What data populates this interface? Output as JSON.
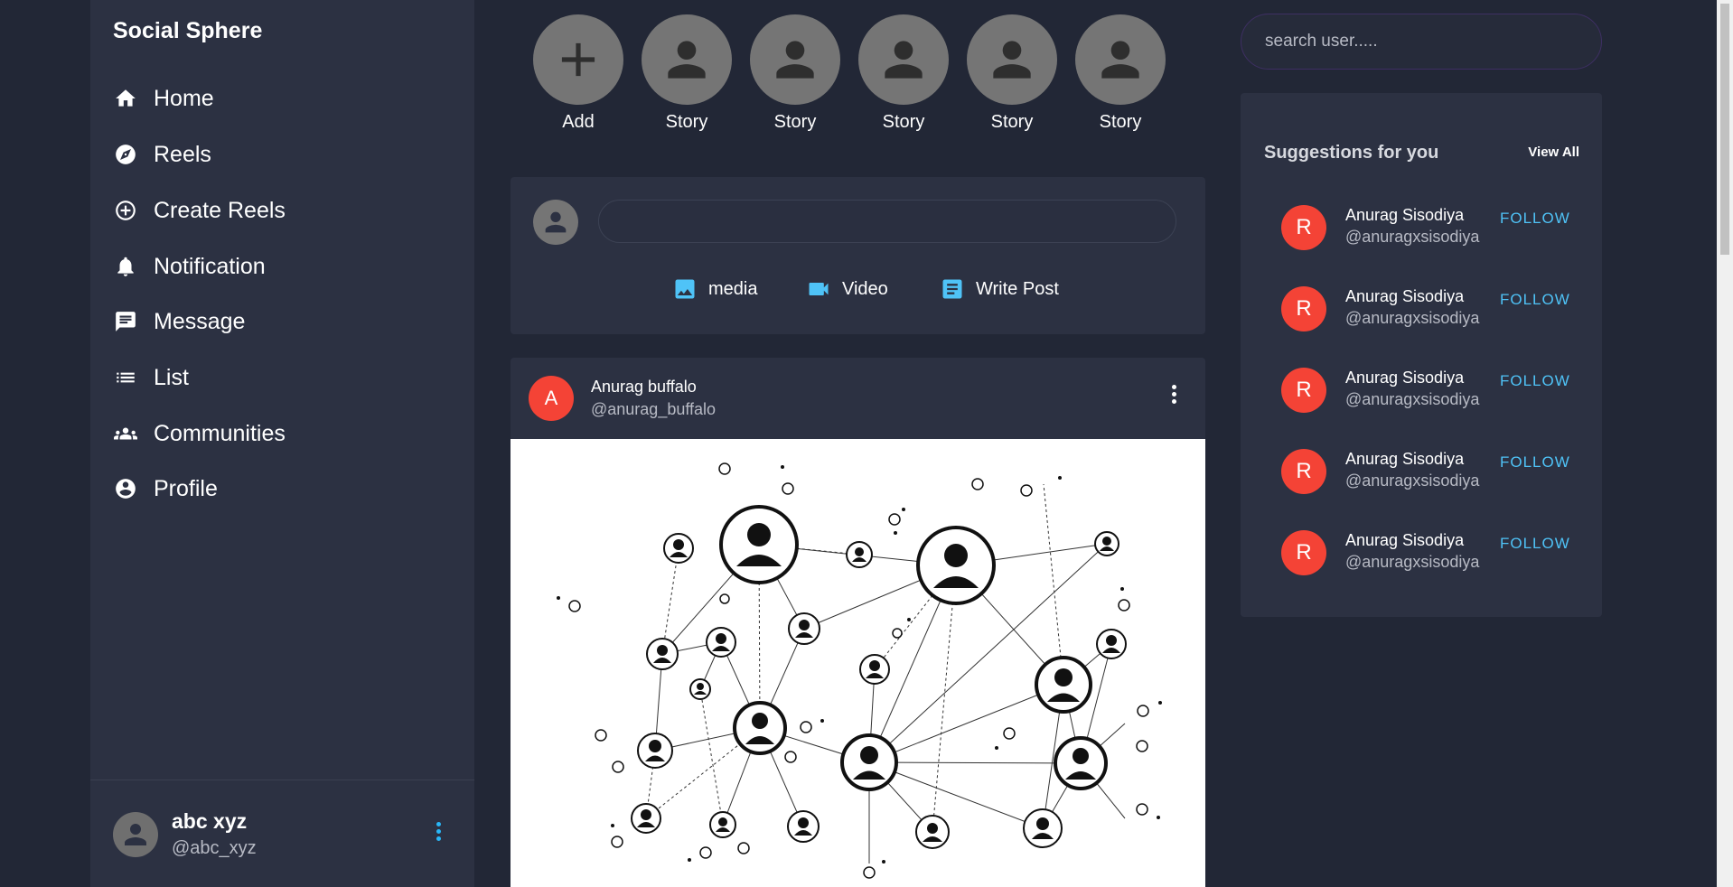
{
  "app": {
    "brand": "Social Sphere"
  },
  "sidebar": {
    "items": [
      {
        "label": "Home",
        "icon": "home-icon"
      },
      {
        "label": "Reels",
        "icon": "compass-icon"
      },
      {
        "label": "Create Reels",
        "icon": "add-circle-icon"
      },
      {
        "label": "Notification",
        "icon": "bell-icon"
      },
      {
        "label": "Message",
        "icon": "chat-icon"
      },
      {
        "label": "List",
        "icon": "list-icon"
      },
      {
        "label": "Communities",
        "icon": "group-icon"
      },
      {
        "label": "Profile",
        "icon": "account-circle-icon"
      }
    ],
    "user": {
      "name": "abc xyz",
      "handle": "@abc_xyz"
    }
  },
  "stories": [
    {
      "label": "Add",
      "icon": "plus-icon"
    },
    {
      "label": "Story",
      "icon": "person-icon"
    },
    {
      "label": "Story",
      "icon": "person-icon"
    },
    {
      "label": "Story",
      "icon": "person-icon"
    },
    {
      "label": "Story",
      "icon": "person-icon"
    },
    {
      "label": "Story",
      "icon": "person-icon"
    }
  ],
  "composer": {
    "input_value": "",
    "actions": [
      {
        "label": "media",
        "icon": "image-icon"
      },
      {
        "label": "Video",
        "icon": "videocam-icon"
      },
      {
        "label": "Write Post",
        "icon": "article-icon"
      }
    ]
  },
  "post": {
    "avatar_letter": "A",
    "name": "Anurag buffalo",
    "handle": "@anurag_buffalo",
    "image": "social-network-illustration"
  },
  "search": {
    "placeholder": "search user....."
  },
  "suggestions": {
    "title": "Suggestions for you",
    "view_all": "View All",
    "items": [
      {
        "avatar_letter": "R",
        "name": "Anurag Sisodiya",
        "handle": "@anuragxsisodiya",
        "action": "FOLLOW"
      },
      {
        "avatar_letter": "R",
        "name": "Anurag Sisodiya",
        "handle": "@anuragxsisodiya",
        "action": "FOLLOW"
      },
      {
        "avatar_letter": "R",
        "name": "Anurag Sisodiya",
        "handle": "@anuragxsisodiya",
        "action": "FOLLOW"
      },
      {
        "avatar_letter": "R",
        "name": "Anurag Sisodiya",
        "handle": "@anuragxsisodiya",
        "action": "FOLLOW"
      },
      {
        "avatar_letter": "R",
        "name": "Anurag Sisodiya",
        "handle": "@anuragxsisodiya",
        "action": "FOLLOW"
      }
    ]
  },
  "colors": {
    "background": "#222736",
    "panel": "#2c3142",
    "accent": "#4fc3f7",
    "avatar_red": "#f44336",
    "story_grey": "#757575"
  }
}
